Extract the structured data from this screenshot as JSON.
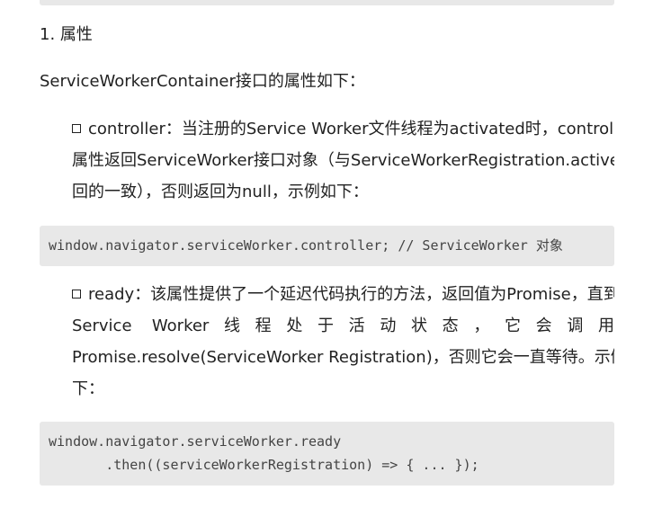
{
  "heading": {
    "number": "1.",
    "title": "属性"
  },
  "intro": "ServiceWorkerContainer接口的属性如下：",
  "bullets": [
    {
      "lines": [
        "controller：当注册的Service Worker文件线程为activated时，controller",
        "属性返回ServiceWorker接口对象（与ServiceWorkerRegistration.active返",
        "回的一致），否则返回为null，示例如下："
      ]
    },
    {
      "lines": [
        "ready：该属性提供了一个延迟代码执行的方法，返回值为Promise，直到",
        "Service Worker线程处于活动状态，它会调用",
        "Promise.resolve(ServiceWorker Registration)，否则它会一直等待。示例如",
        "下："
      ]
    }
  ],
  "code": [
    {
      "lines": [
        "window.navigator.serviceWorker.controller; // ServiceWorker 对象"
      ]
    },
    {
      "lines": [
        "window.navigator.serviceWorker.ready",
        "       .then((serviceWorkerRegistration) => { ... });"
      ]
    }
  ]
}
